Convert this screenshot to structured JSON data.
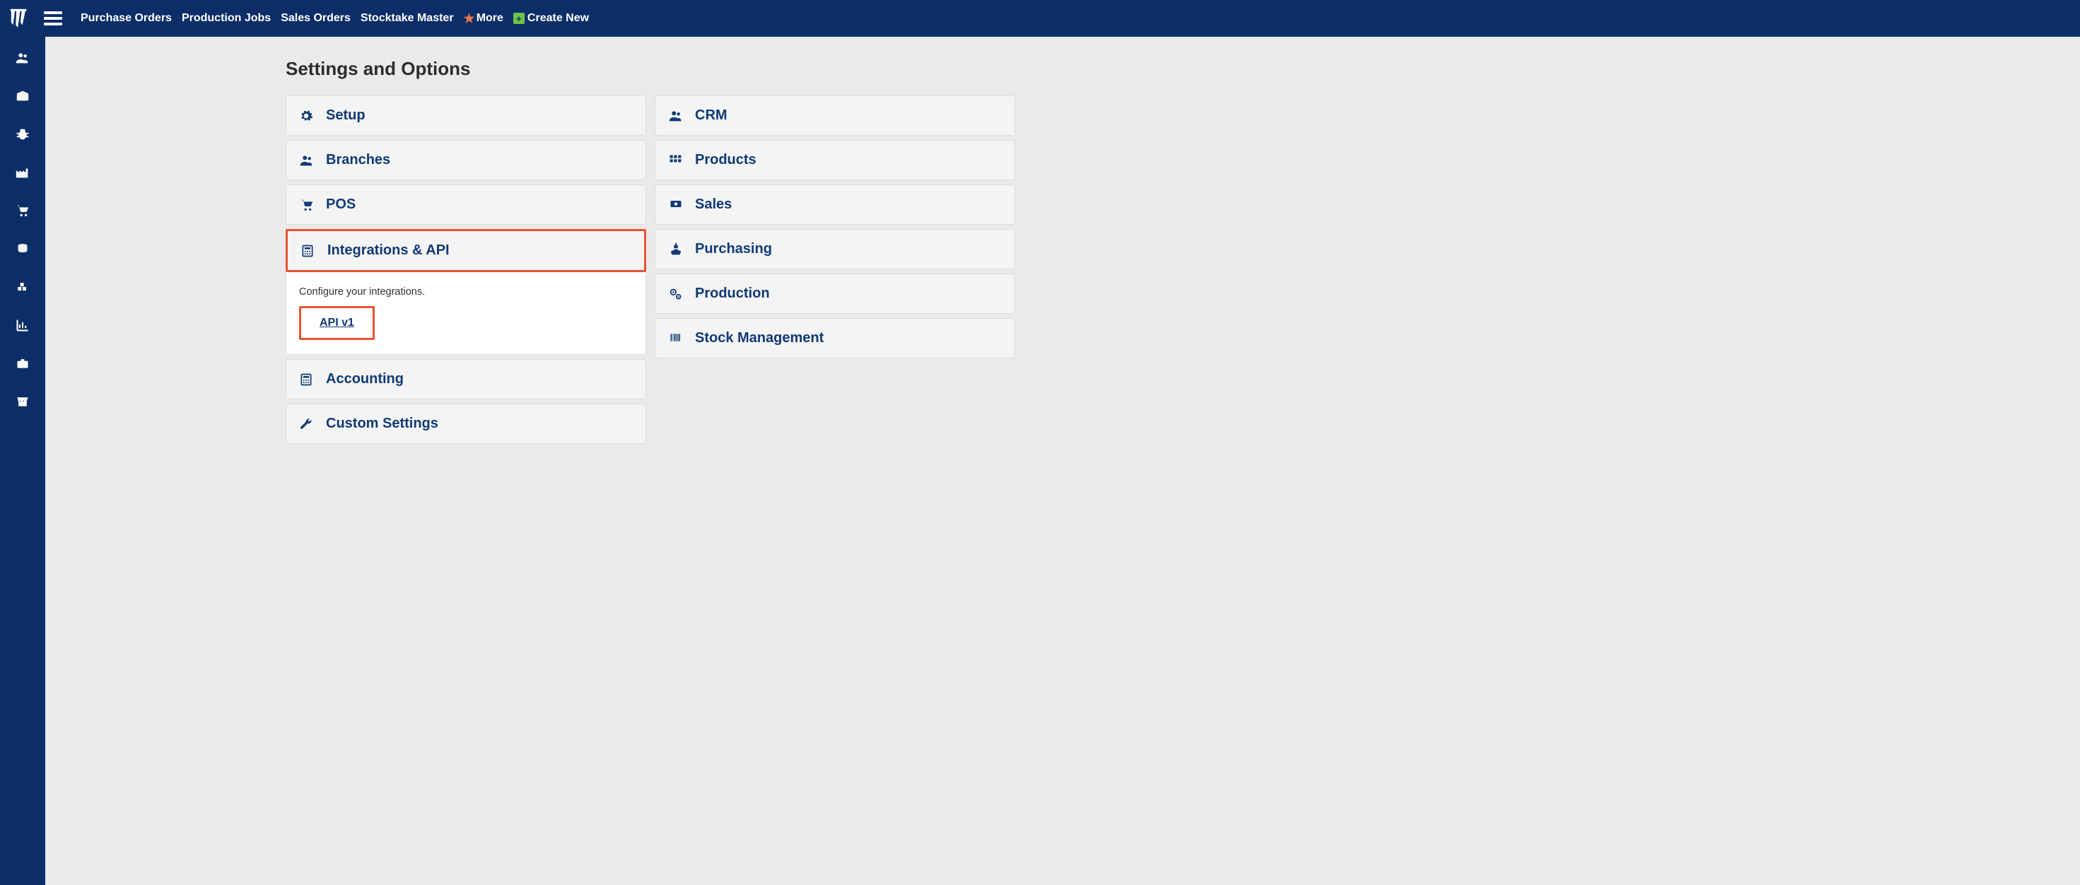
{
  "topnav": {
    "links": [
      "Purchase Orders",
      "Production Jobs",
      "Sales Orders",
      "Stocktake Master"
    ],
    "more": "More",
    "create": "Create New"
  },
  "page": {
    "title": "Settings and Options"
  },
  "left_cards": {
    "setup": "Setup",
    "branches": "Branches",
    "pos": "POS",
    "integrations": "Integrations & API",
    "integrations_desc": "Configure your integrations.",
    "integrations_sub": "API v1",
    "accounting": "Accounting",
    "custom": "Custom Settings"
  },
  "right_cards": {
    "crm": "CRM",
    "products": "Products",
    "sales": "Sales",
    "purchasing": "Purchasing",
    "production": "Production",
    "stock": "Stock Management"
  }
}
